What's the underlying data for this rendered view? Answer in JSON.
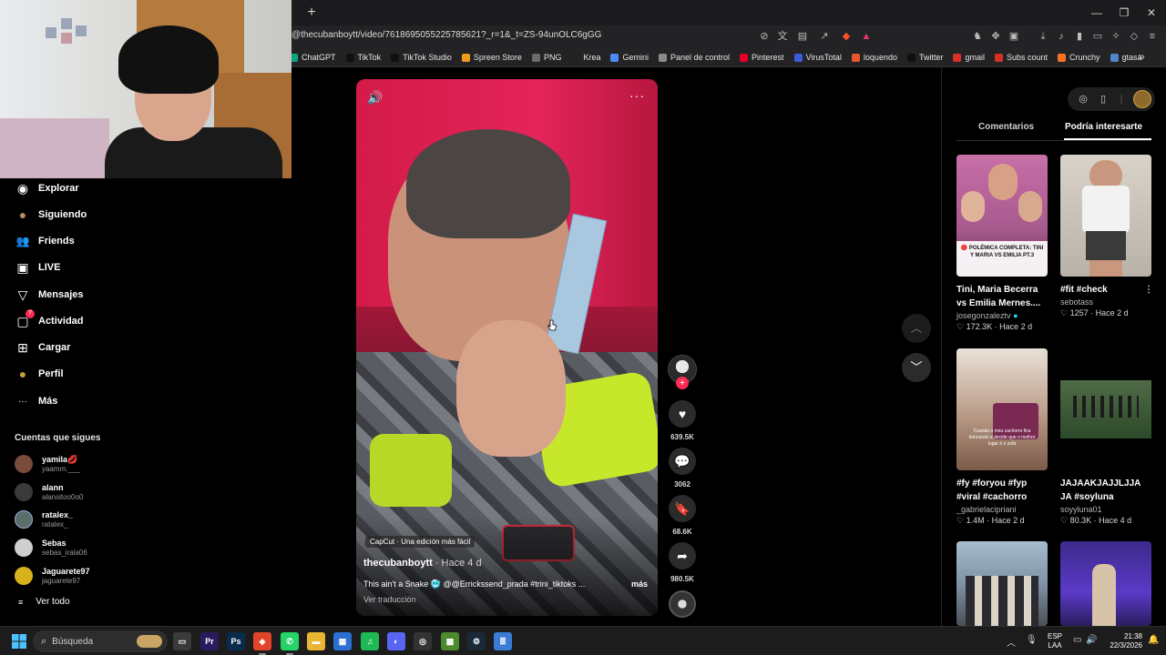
{
  "browser": {
    "url": "@thecubanboytt/video/7618695055225785621?_r=1&_t=ZS-94unOLC6gGG",
    "new_tab_glyph": "+",
    "bookmarks": [
      {
        "label": "ChatGPT",
        "color": "#10a37f"
      },
      {
        "label": "TikTok",
        "color": "#111111"
      },
      {
        "label": "TikTok Studio",
        "color": "#111111"
      },
      {
        "label": "Spreen Store",
        "color": "#f29a1b"
      },
      {
        "label": "PNG",
        "color": "#6b6b6b"
      },
      {
        "label": "Krea",
        "color": "#222222"
      },
      {
        "label": "Gemini",
        "color": "#4b8bf5"
      },
      {
        "label": "Panel de control",
        "color": "#8a8a8a"
      },
      {
        "label": "Pinterest",
        "color": "#e60023"
      },
      {
        "label": "VirusTotal",
        "color": "#3a5bd9"
      },
      {
        "label": "loquendo",
        "color": "#e8572a"
      },
      {
        "label": "Twitter",
        "color": "#111111"
      },
      {
        "label": "gmail",
        "color": "#d93025"
      },
      {
        "label": "Subs count",
        "color": "#d93025"
      },
      {
        "label": "Crunchy",
        "color": "#f47521"
      },
      {
        "label": "gtasa",
        "color": "#4e86c9"
      }
    ]
  },
  "sidebar": {
    "nav": [
      {
        "label": "Explorar",
        "icon": "compass-icon",
        "glyph": "◉"
      },
      {
        "label": "Siguiendo",
        "icon": "following-avatar-icon",
        "glyph": "●"
      },
      {
        "label": "Friends",
        "icon": "friends-icon",
        "glyph": "👥"
      },
      {
        "label": "LIVE",
        "icon": "live-icon",
        "glyph": "▣"
      },
      {
        "label": "Mensajes",
        "icon": "messages-icon",
        "glyph": "▽"
      },
      {
        "label": "Actividad",
        "icon": "activity-icon",
        "glyph": "▢"
      },
      {
        "label": "Cargar",
        "icon": "upload-icon",
        "glyph": "⊞"
      },
      {
        "label": "Perfil",
        "icon": "profile-avatar-icon",
        "glyph": "●"
      },
      {
        "label": "Más",
        "icon": "more-icon",
        "glyph": "···"
      }
    ],
    "activity_badge": "7",
    "following_title": "Cuentas que sigues",
    "accounts": [
      {
        "name": "yamila💋",
        "user": "yaamm.___",
        "color": "#7a4a3a"
      },
      {
        "name": "alann",
        "user": "alansitoo0o0",
        "color": "#3a3a3a"
      },
      {
        "name": "ratalex_",
        "user": "ratalex_",
        "color": "#5a6e6a"
      },
      {
        "name": "Sebas",
        "user": "sebas_irala06",
        "color": "#cfcfcf"
      },
      {
        "name": "Jaguarete97",
        "user": "jaguarete97",
        "color": "#d8b21c"
      }
    ],
    "see_all": "Ver todo"
  },
  "video": {
    "capcut": "CapCut · Una edición más fácil",
    "author": "thecubanboytt",
    "time": " · Hace 4 d",
    "caption": "This ain't a Snake 🥶 @@Errickssend_prada #trini_tiktoks ...",
    "more": "más",
    "translate": "Ver traducción",
    "menu_glyph": "···",
    "sound_glyph": "🔊"
  },
  "actions": {
    "like_count": "639.5K",
    "comment_count": "3062",
    "save_count": "68.6K",
    "share_count": "980.5K"
  },
  "right_panel": {
    "tabs": [
      "Comentarios",
      "Podría interesarte"
    ],
    "active_tab": 1,
    "cards": [
      {
        "title": "Tini, Maria Becerra vs Emilia Mernes....",
        "author": "josegonzaleztv",
        "verified": true,
        "likes": "172.3K",
        "time": "Hace 2 d",
        "thumb_color": "#c86fa8",
        "overlay": "🔴 POLÉMICA COMPLETA: TINI Y MARIA VS EMILIA PT.3"
      },
      {
        "title": "#fit #check",
        "author": "sebotass",
        "verified": false,
        "likes": "1257",
        "time": "Hace 2 d",
        "thumb_color": "#c9c3bb",
        "overlay": ""
      },
      {
        "title": "#fy #foryou #fyp #viral #cachorro",
        "author": "_gabrielacipriani",
        "verified": false,
        "likes": "1.4M",
        "time": "Hace 2 d",
        "thumb_color": "#8a6a58",
        "overlay": "Cuando o meu cachorro fica brincando e decide que o melhor lugar é o sofá"
      },
      {
        "title": "JAJAAKJAJJLJJA JA #soyluna",
        "author": "soyyluna01",
        "verified": false,
        "likes": "80.3K",
        "time": "Hace 4 d",
        "thumb_color": "#3f5a3a",
        "overlay": ""
      },
      {
        "title": "",
        "author": "",
        "verified": false,
        "likes": "",
        "time": "",
        "thumb_color": "#7f93a6",
        "overlay": ""
      },
      {
        "title": "",
        "author": "",
        "verified": false,
        "likes": "",
        "time": "",
        "thumb_color": "#3c2a8a",
        "overlay": ""
      }
    ]
  },
  "taskbar": {
    "search_placeholder": "Búsqueda",
    "apps": [
      {
        "name": "task-view",
        "label": "▭",
        "color": "#3a3a3a"
      },
      {
        "name": "premiere",
        "label": "Pr",
        "color": "#2a1a5e"
      },
      {
        "name": "photoshop",
        "label": "Ps",
        "color": "#0a2a4e"
      },
      {
        "name": "brave",
        "label": "◈",
        "color": "#e0442a"
      },
      {
        "name": "whatsapp",
        "label": "✆",
        "color": "#25d366"
      },
      {
        "name": "file-explorer",
        "label": "▬",
        "color": "#e8b633"
      },
      {
        "name": "ms-store",
        "label": "▦",
        "color": "#2b6fd3"
      },
      {
        "name": "spotify",
        "label": "♫",
        "color": "#1db954"
      },
      {
        "name": "discord",
        "label": "◐",
        "color": "#5865f2"
      },
      {
        "name": "obs",
        "label": "◎",
        "color": "#333333"
      },
      {
        "name": "minecraft",
        "label": "▩",
        "color": "#4c8a2e"
      },
      {
        "name": "steam",
        "label": "⚙",
        "color": "#1b2838"
      },
      {
        "name": "notepad",
        "label": "≣",
        "color": "#3a7bd5"
      }
    ],
    "lang_line1": "ESP",
    "lang_line2": "LAA",
    "time": "21:38",
    "date": "22/3/2026"
  }
}
